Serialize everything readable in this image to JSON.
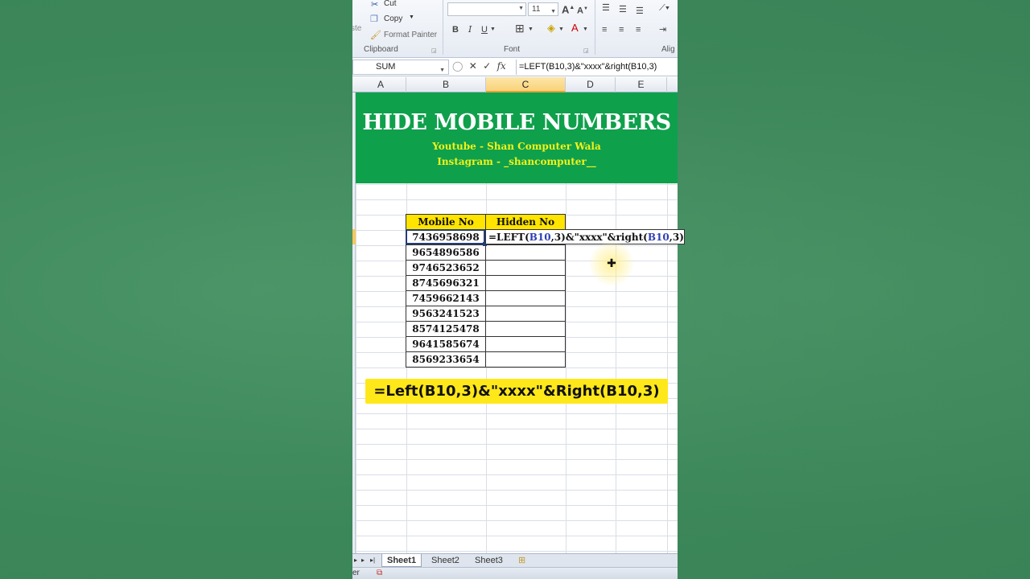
{
  "ribbon": {
    "cut_label": "Cut",
    "copy_label": "Copy",
    "format_painter_label": "Format Painter",
    "paste_partial": "ste",
    "clipboard_group": "Clipboard",
    "font_group": "Font",
    "align_group": "Alig",
    "font_size": "11"
  },
  "formula_bar": {
    "name_box": "SUM",
    "fx": "fx",
    "formula": "=LEFT(B10,3)&\"xxxx\"&right(B10,3)"
  },
  "columns": [
    "A",
    "B",
    "C",
    "D",
    "E"
  ],
  "banner": {
    "title": "HIDE MOBILE NUMBERS",
    "youtube": "Youtube - Shan Computer Wala",
    "instagram": "Instagram - _shancomputer__"
  },
  "table": {
    "headers": [
      "Mobile No",
      "Hidden No"
    ],
    "mobile_numbers": [
      "7436958698",
      "9654896586",
      "9746523652",
      "8745696321",
      "7459662143",
      "9563241523",
      "8574125478",
      "9641585674",
      "8569233654"
    ]
  },
  "editing_cell": {
    "prefix": "=LEFT(",
    "ref1": "B10",
    "middle": ",3)&\"xxxx\"&right(",
    "ref2": "B10",
    "suffix": ",3)"
  },
  "callout": "=Left(B10,3)&\"xxxx\"&Right(B10,3)",
  "sheets": [
    "Sheet1",
    "Sheet2",
    "Sheet3"
  ],
  "status_text": "er",
  "colors": {
    "banner_green": "#0fa04c",
    "banner_sub_yellow": "#f2f21a",
    "header_yellow": "#ffe400",
    "callout_yellow": "#ffe81a",
    "ref_blue": "#2d3fb5"
  }
}
